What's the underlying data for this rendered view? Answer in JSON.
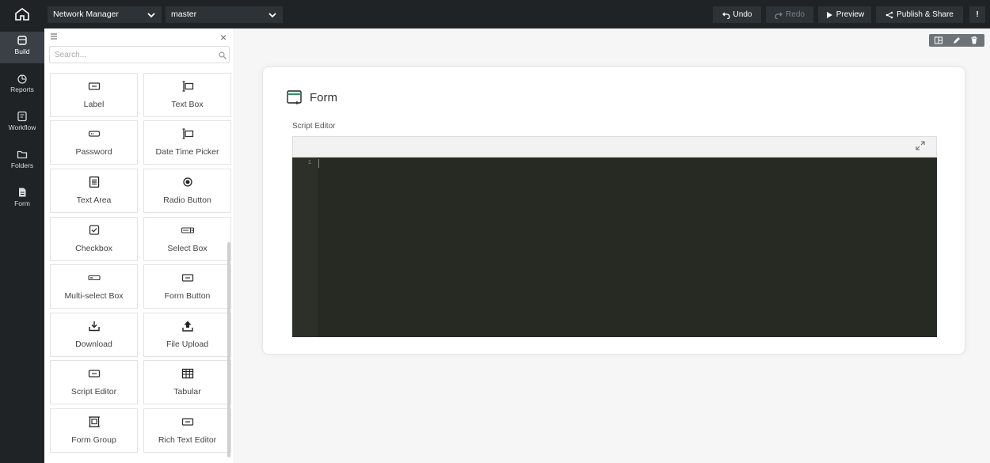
{
  "topbar": {
    "home_icon": "home-icon",
    "app_name": "Network Manager",
    "branch_name": "master",
    "undo_label": "Undo",
    "redo_label": "Redo",
    "preview_label": "Preview",
    "publish_label": "Publish & Share",
    "more_label": "!"
  },
  "leftnav": {
    "items": [
      {
        "label": "Build",
        "icon": "build-icon"
      },
      {
        "label": "Reports",
        "icon": "reports-icon"
      },
      {
        "label": "Workflow",
        "icon": "workflow-icon"
      },
      {
        "label": "Folders",
        "icon": "folder-icon"
      },
      {
        "label": "Form",
        "icon": "form-icon"
      }
    ]
  },
  "panel": {
    "search_placeholder": "Search...",
    "components": [
      {
        "label": "Label",
        "icon": "label-icon"
      },
      {
        "label": "Text Box",
        "icon": "textbox-icon"
      },
      {
        "label": "Password",
        "icon": "password-icon"
      },
      {
        "label": "Date Time Picker",
        "icon": "datetime-icon"
      },
      {
        "label": "Text Area",
        "icon": "textarea-icon"
      },
      {
        "label": "Radio Button",
        "icon": "radio-icon"
      },
      {
        "label": "Checkbox",
        "icon": "checkbox-icon"
      },
      {
        "label": "Select Box",
        "icon": "selectbox-icon"
      },
      {
        "label": "Multi-select Box",
        "icon": "multiselect-icon"
      },
      {
        "label": "Form Button",
        "icon": "formbutton-icon"
      },
      {
        "label": "Download",
        "icon": "download-icon"
      },
      {
        "label": "File Upload",
        "icon": "upload-icon"
      },
      {
        "label": "Script Editor",
        "icon": "scripteditor-icon"
      },
      {
        "label": "Tabular",
        "icon": "table-icon"
      },
      {
        "label": "Form Group",
        "icon": "formgroup-icon"
      },
      {
        "label": "Rich Text Editor",
        "icon": "richtext-icon"
      }
    ]
  },
  "canvas": {
    "form_title": "Form",
    "field_label": "Script Editor",
    "line_numbers": "1"
  }
}
